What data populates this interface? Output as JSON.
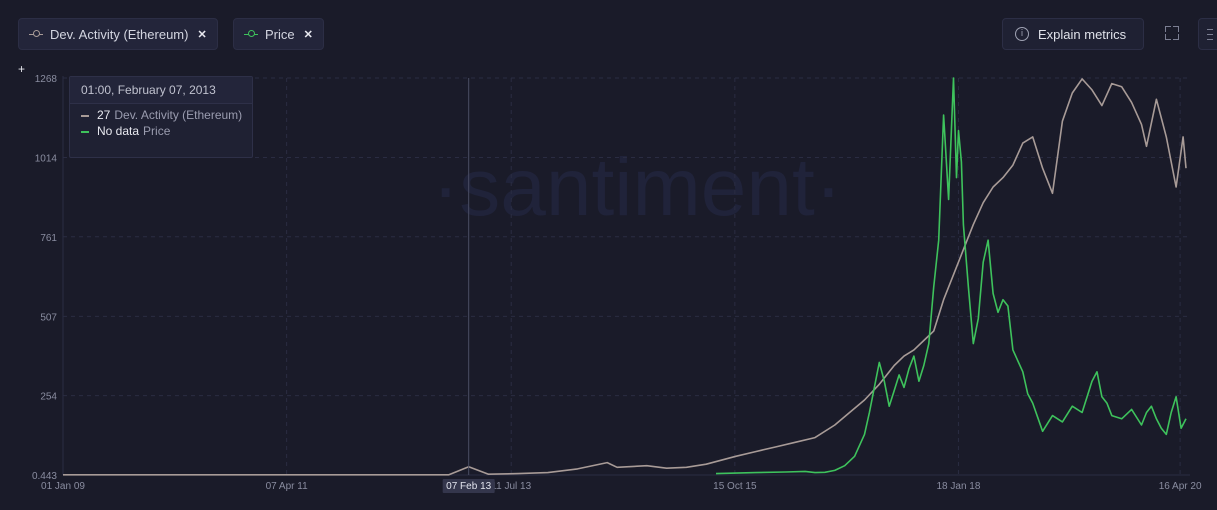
{
  "metrics": [
    {
      "label": "Dev. Activity (Ethereum)",
      "color": "#a89b97",
      "remove_icon": "close-icon"
    },
    {
      "label": "Price",
      "color": "#3ec25c",
      "remove_icon": "close-icon"
    }
  ],
  "toolbar": {
    "explain_label": "Explain metrics",
    "info_icon": "info-icon",
    "fullscreen_icon": "fullscreen-icon",
    "menu_icon": "menu-icon"
  },
  "watermark": "·santiment·",
  "tooltip": {
    "date": "01:00, February 07, 2013",
    "rows": [
      {
        "value": "27",
        "name": "Dev. Activity (Ethereum)",
        "color": "#a89b97"
      },
      {
        "value": "No data",
        "name": "Price",
        "color": "#3ec25c"
      }
    ]
  },
  "crosshair_label": "07 Feb 13",
  "chart_data": {
    "type": "line",
    "x_tick_labels": [
      "01 Jan 09",
      "07 Apr 11",
      "11 Jul 13",
      "15 Oct 15",
      "18 Jan 18",
      "16 Apr 20"
    ],
    "x_ticks": [
      2009.0,
      2011.26,
      2013.53,
      2015.79,
      2018.05,
      2020.29
    ],
    "y_tick_labels": [
      "0.443",
      "254",
      "507",
      "761",
      "1014",
      "1268"
    ],
    "y_ticks": [
      0.443,
      254,
      507,
      761,
      1014,
      1268
    ],
    "ylim": [
      0.443,
      1268
    ],
    "xlim": [
      2009.0,
      2020.39
    ],
    "grid": true,
    "crosshair_x": 2013.1,
    "series": [
      {
        "name": "Dev. Activity (Ethereum)",
        "color": "#a89b97",
        "x": [
          2009.0,
          2012.9,
          2013.1,
          2013.3,
          2013.6,
          2013.9,
          2014.2,
          2014.5,
          2014.6,
          2014.9,
          2015.1,
          2015.3,
          2015.5,
          2015.8,
          2016.0,
          2016.2,
          2016.4,
          2016.6,
          2016.8,
          2016.95,
          2017.1,
          2017.25,
          2017.4,
          2017.5,
          2017.6,
          2017.7,
          2017.8,
          2017.9,
          2018.0,
          2018.1,
          2018.2,
          2018.3,
          2018.4,
          2018.5,
          2018.6,
          2018.7,
          2018.8,
          2018.9,
          2019.0,
          2019.1,
          2019.2,
          2019.3,
          2019.4,
          2019.5,
          2019.6,
          2019.7,
          2019.8,
          2019.9,
          2019.95,
          2020.05,
          2020.15,
          2020.25,
          2020.32,
          2020.35
        ],
        "values": [
          1,
          1,
          27,
          3,
          5,
          8,
          20,
          40,
          25,
          30,
          22,
          25,
          35,
          60,
          75,
          90,
          105,
          120,
          160,
          200,
          240,
          290,
          350,
          380,
          400,
          430,
          460,
          560,
          640,
          720,
          800,
          870,
          920,
          950,
          990,
          1060,
          1080,
          980,
          900,
          1130,
          1220,
          1265,
          1230,
          1180,
          1250,
          1240,
          1190,
          1120,
          1050,
          1200,
          1080,
          920,
          1080,
          980
        ]
      },
      {
        "name": "Price",
        "color": "#3ec25c",
        "x": [
          2015.6,
          2016.0,
          2016.3,
          2016.5,
          2016.6,
          2016.7,
          2016.8,
          2016.9,
          2017.0,
          2017.1,
          2017.15,
          2017.25,
          2017.3,
          2017.35,
          2017.4,
          2017.45,
          2017.5,
          2017.55,
          2017.6,
          2017.65,
          2017.7,
          2017.75,
          2017.8,
          2017.85,
          2017.9,
          2017.95,
          2018.0,
          2018.03,
          2018.05,
          2018.08,
          2018.1,
          2018.15,
          2018.2,
          2018.25,
          2018.3,
          2018.35,
          2018.4,
          2018.45,
          2018.5,
          2018.55,
          2018.6,
          2018.7,
          2018.75,
          2018.8,
          2018.9,
          2019.0,
          2019.1,
          2019.2,
          2019.3,
          2019.35,
          2019.4,
          2019.45,
          2019.5,
          2019.55,
          2019.6,
          2019.7,
          2019.8,
          2019.9,
          2019.95,
          2020.0,
          2020.05,
          2020.1,
          2020.15,
          2020.2,
          2020.25,
          2020.3,
          2020.35
        ],
        "values": [
          5,
          8,
          10,
          12,
          8,
          9,
          15,
          30,
          60,
          130,
          200,
          360,
          300,
          220,
          270,
          320,
          280,
          340,
          380,
          300,
          350,
          420,
          600,
          750,
          1150,
          880,
          1268,
          950,
          1100,
          1000,
          800,
          600,
          420,
          500,
          680,
          750,
          580,
          520,
          560,
          540,
          400,
          330,
          260,
          230,
          140,
          190,
          170,
          220,
          200,
          250,
          300,
          330,
          250,
          230,
          190,
          180,
          210,
          160,
          200,
          220,
          180,
          150,
          130,
          200,
          250,
          150,
          180
        ]
      }
    ]
  }
}
